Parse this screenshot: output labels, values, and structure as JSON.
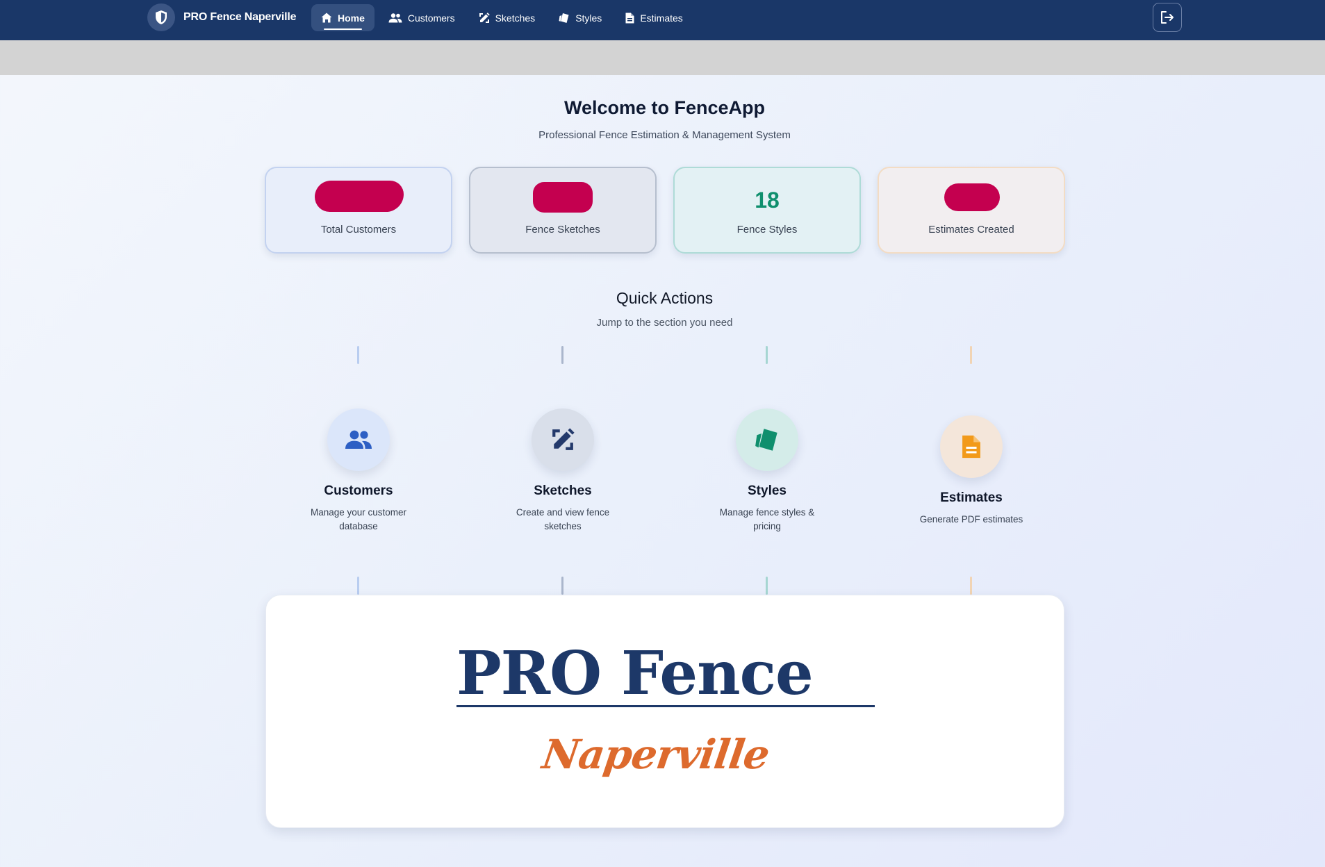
{
  "navbar": {
    "brand_name": "PRO Fence Naperville",
    "items": [
      {
        "label": "Home",
        "icon": "home-icon",
        "active": true
      },
      {
        "label": "Customers",
        "icon": "users-icon",
        "active": false
      },
      {
        "label": "Sketches",
        "icon": "pen-ruler-icon",
        "active": false
      },
      {
        "label": "Styles",
        "icon": "swatches-icon",
        "active": false
      },
      {
        "label": "Estimates",
        "icon": "file-icon",
        "active": false
      }
    ],
    "logout_icon": "logout-icon"
  },
  "header": {
    "title": "Welcome to FenceApp",
    "subtitle": "Professional Fence Estimation & Management System"
  },
  "stats": [
    {
      "label": "Total Customers",
      "value": "",
      "redacted": true
    },
    {
      "label": "Fence Sketches",
      "value": "",
      "redacted": true
    },
    {
      "label": "Fence Styles",
      "value": "18",
      "redacted": false
    },
    {
      "label": "Estimates Created",
      "value": "",
      "redacted": true
    }
  ],
  "quick_actions": {
    "title": "Quick Actions",
    "subtitle": "Jump to the section you need",
    "items": [
      {
        "title": "Customers",
        "description": "Manage your customer database",
        "icon": "users-icon"
      },
      {
        "title": "Sketches",
        "description": "Create and view fence sketches",
        "icon": "pen-ruler-icon"
      },
      {
        "title": "Styles",
        "description": "Manage fence styles & pricing",
        "icon": "swatches-icon"
      },
      {
        "title": "Estimates",
        "description": "Generate PDF estimates",
        "icon": "file-icon"
      }
    ]
  },
  "logo_card": {
    "main_text": "PRO Fence",
    "script_text": "Naperville"
  },
  "colors": {
    "navbar": "#1a3768",
    "redaction": "#c4004f",
    "styles_accent": "#0f8f6d",
    "customers_accent": "#2d5fc4",
    "sketches_accent": "#23396b",
    "estimates_accent": "#f29a1a",
    "logo_blue": "#1d3868",
    "logo_orange": "#dd6a2d"
  }
}
